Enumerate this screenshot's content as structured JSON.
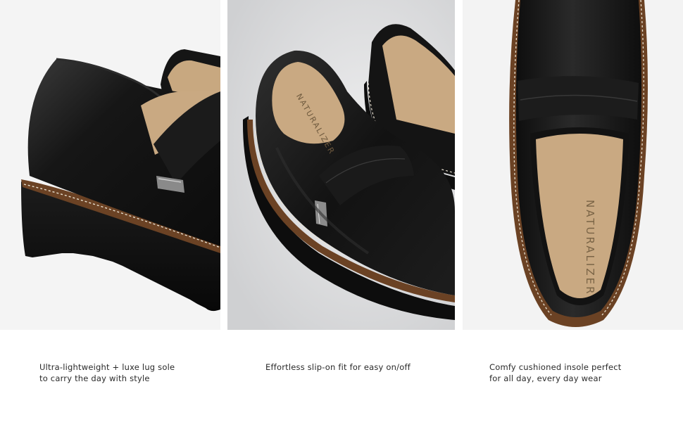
{
  "panels": [
    {
      "caption_lines": [
        "Ultra-lightweight + luxe lug sole",
        "to carry the day with style"
      ],
      "background": "#f4f4f4"
    },
    {
      "caption_lines": [
        "Effortless slip-on fit for easy on/off"
      ],
      "background": "#d9dadc",
      "insole_brand": "NATURALIZER"
    },
    {
      "caption_lines": [
        "Comfy cushioned insole perfect",
        "for all day, every day wear"
      ],
      "background": "#f3f3f3",
      "insole_brand": "NATURALIZER"
    }
  ],
  "colors": {
    "leather": "#141414",
    "sole": "#101010",
    "welt": "#6b4224",
    "insole": "#c9a982",
    "stitch": "#e8e0d0"
  }
}
